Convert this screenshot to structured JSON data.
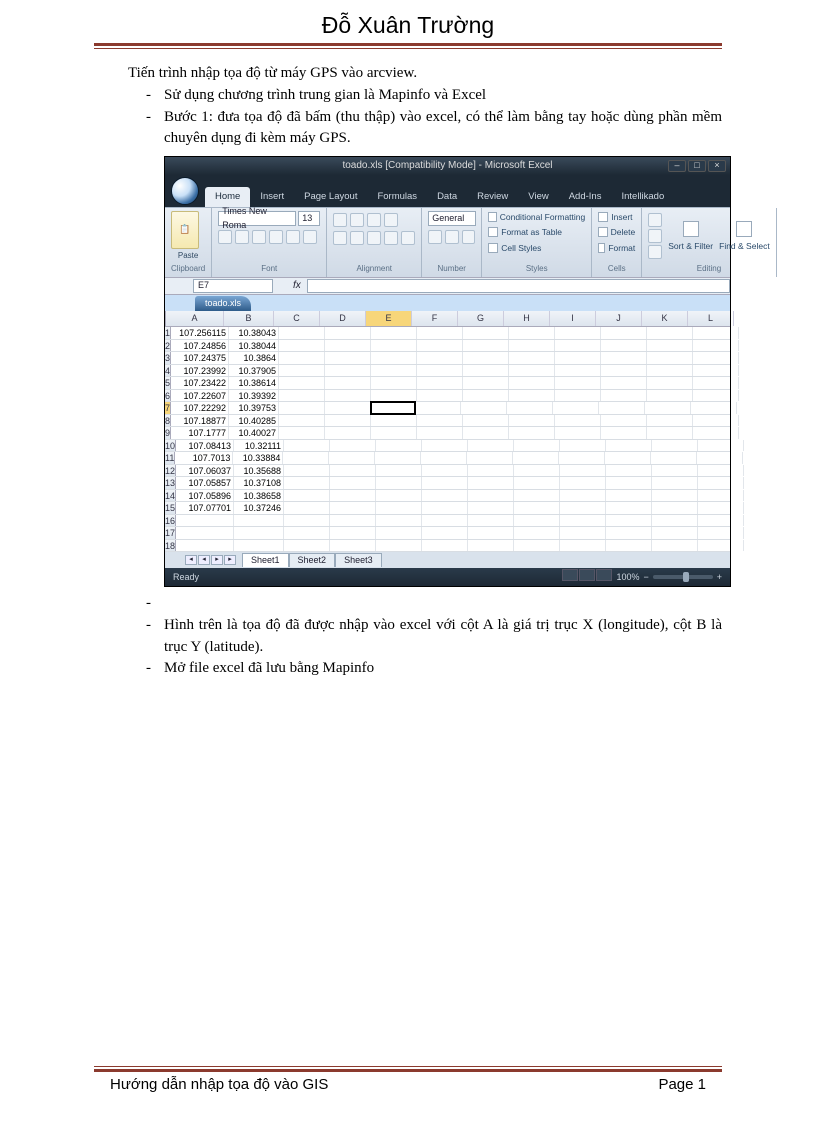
{
  "header": {
    "title": "Đỗ Xuân Trường"
  },
  "body": {
    "intro": "Tiến trình nhập tọa độ từ máy GPS vào arcview.",
    "b1": "Sử dụng chương trình trung gian là Mapinfo và Excel",
    "b2": "Bước 1: đưa tọa độ đã bấm (thu thập) vào excel, có thể làm bằng tay hoặc dùng phần mềm chuyên dụng đi kèm máy GPS.",
    "b3": "Hình trên là tọa độ đã được nhập vào excel với cột A là giá trị trục X (longitude), cột B là trục Y (latitude).",
    "b4": "Mở file excel đã lưu bằng Mapinfo"
  },
  "excel": {
    "titlebar": "toado.xls  [Compatibility Mode] - Microsoft Excel",
    "tabs": [
      "Home",
      "Insert",
      "Page Layout",
      "Formulas",
      "Data",
      "Review",
      "View",
      "Add-Ins",
      "Intellikado"
    ],
    "font_name": "Times New Roma",
    "font_size": "13",
    "number_format": "General",
    "groups": {
      "clipboard": "Clipboard",
      "font": "Font",
      "alignment": "Alignment",
      "number": "Number",
      "styles": "Styles",
      "cells": "Cells",
      "editing": "Editing"
    },
    "style_btns": {
      "cond": "Conditional Formatting",
      "table": "Format as Table",
      "cell": "Cell Styles"
    },
    "cell_btns": {
      "insert": "Insert",
      "delete": "Delete",
      "format": "Format"
    },
    "edit_btns": {
      "sort": "Sort & Filter",
      "find": "Find & Select"
    },
    "paste": "Paste",
    "namebox": "E7",
    "fx": "fx",
    "doctab": "toado.xls",
    "columns": [
      "A",
      "B",
      "C",
      "D",
      "E",
      "F",
      "G",
      "H",
      "I",
      "J",
      "K",
      "L"
    ],
    "rows": [
      {
        "n": "1",
        "a": "107.256115",
        "b": "10.38043"
      },
      {
        "n": "2",
        "a": "107.24856",
        "b": "10.38044"
      },
      {
        "n": "3",
        "a": "107.24375",
        "b": "10.3864"
      },
      {
        "n": "4",
        "a": "107.23992",
        "b": "10.37905"
      },
      {
        "n": "5",
        "a": "107.23422",
        "b": "10.38614"
      },
      {
        "n": "6",
        "a": "107.22607",
        "b": "10.39392"
      },
      {
        "n": "7",
        "a": "107.22292",
        "b": "10.39753"
      },
      {
        "n": "8",
        "a": "107.18877",
        "b": "10.40285"
      },
      {
        "n": "9",
        "a": "107.1777",
        "b": "10.40027"
      },
      {
        "n": "10",
        "a": "107.08413",
        "b": "10.32111"
      },
      {
        "n": "11",
        "a": "107.7013",
        "b": "10.33884"
      },
      {
        "n": "12",
        "a": "107.06037",
        "b": "10.35688"
      },
      {
        "n": "13",
        "a": "107.05857",
        "b": "10.37108"
      },
      {
        "n": "14",
        "a": "107.05896",
        "b": "10.38658"
      },
      {
        "n": "15",
        "a": "107.07701",
        "b": "10.37246"
      },
      {
        "n": "16",
        "a": "",
        "b": ""
      },
      {
        "n": "17",
        "a": "",
        "b": ""
      },
      {
        "n": "18",
        "a": "",
        "b": ""
      }
    ],
    "sheets": [
      "Sheet1",
      "Sheet2",
      "Sheet3"
    ],
    "status": "Ready",
    "zoom": "100%"
  },
  "footer": {
    "title": "Hướng dẫn nhập tọa độ vào GIS",
    "page_label": "Page ",
    "page_num": "1"
  }
}
